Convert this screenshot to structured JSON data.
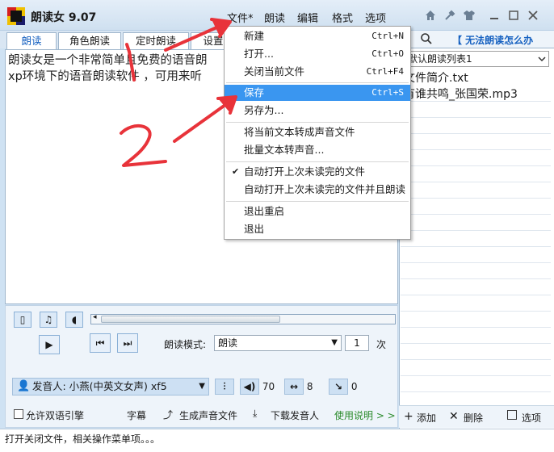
{
  "app": {
    "title": "朗读女 9.07"
  },
  "menu": [
    "文件*",
    "朗读",
    "编辑",
    "格式",
    "选项"
  ],
  "tabs": [
    "朗读",
    "角色朗读",
    "定时朗读",
    "设置"
  ],
  "editor": {
    "lines": [
      "朗读女是一个非常简单且免费的语音朗",
      "xp环境下的语音朗读软件 ，可用来听"
    ]
  },
  "right": {
    "link": "【 无法朗读怎么办",
    "playlist": "默认朗读列表1",
    "files": [
      "文件简介.txt",
      "有谁共鸣_张国荣.mp3"
    ],
    "footer": {
      "add": "添加",
      "delete": "删除",
      "options": "选项"
    }
  },
  "controls": {
    "mode_label": "朗读模式:",
    "mode_value": "朗读",
    "count": "1",
    "count_unit": "次",
    "voice": "发音人: 小燕(中英文女声) xf5",
    "params": [
      "70",
      "8",
      "0"
    ],
    "bilingual": "允许双语引擎",
    "subtitle": "字幕",
    "gen_audio": "生成声音文件",
    "download_voice": "下载发音人",
    "help": "使用说明 > >"
  },
  "status": "打开关闭文件，相关操作菜单项。。。",
  "file_menu": {
    "items": [
      {
        "label": "新建",
        "shortcut": "Ctrl+N"
      },
      {
        "label": "打开...",
        "shortcut": "Ctrl+O"
      },
      {
        "label": "关闭当前文件",
        "shortcut": "Ctrl+F4"
      },
      {
        "label": "保存",
        "shortcut": "Ctrl+S"
      },
      {
        "label": "另存为...",
        "shortcut": ""
      },
      {
        "label": "将当前文本转成声音文件",
        "shortcut": ""
      },
      {
        "label": "批量文本转声音...",
        "shortcut": ""
      },
      {
        "label": "自动打开上次未读完的文件",
        "shortcut": ""
      },
      {
        "label": "自动打开上次未读完的文件并且朗读",
        "shortcut": ""
      },
      {
        "label": "退出重启",
        "shortcut": ""
      },
      {
        "label": "退出",
        "shortcut": ""
      }
    ]
  },
  "colors": {
    "accent": "#3a96f0",
    "annotation": "#e8333a",
    "link": "#1560c0"
  },
  "icons": [
    "home-icon",
    "tools-icon",
    "shirt-icon",
    "minimize-icon",
    "maximize-icon",
    "close-icon",
    "search-icon",
    "play-icon",
    "prev-icon",
    "next-icon"
  ]
}
